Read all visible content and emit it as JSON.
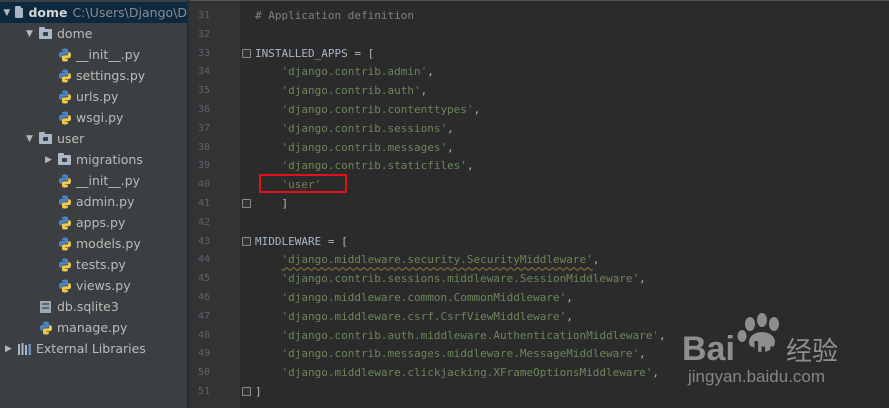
{
  "project": {
    "root_name": "dome",
    "root_path": "C:\\Users\\Django\\D",
    "tree": [
      {
        "label": "dome",
        "depth": 1,
        "kind": "pkg-folder",
        "expanded": true
      },
      {
        "label": "__init__.py",
        "depth": 2,
        "kind": "py"
      },
      {
        "label": "settings.py",
        "depth": 2,
        "kind": "py"
      },
      {
        "label": "urls.py",
        "depth": 2,
        "kind": "py"
      },
      {
        "label": "wsgi.py",
        "depth": 2,
        "kind": "py"
      },
      {
        "label": "user",
        "depth": 1,
        "kind": "pkg-folder",
        "expanded": true
      },
      {
        "label": "migrations",
        "depth": 2,
        "kind": "pkg-folder",
        "expanded": false
      },
      {
        "label": "__init__.py",
        "depth": 2,
        "kind": "py"
      },
      {
        "label": "admin.py",
        "depth": 2,
        "kind": "py"
      },
      {
        "label": "apps.py",
        "depth": 2,
        "kind": "py"
      },
      {
        "label": "models.py",
        "depth": 2,
        "kind": "py"
      },
      {
        "label": "tests.py",
        "depth": 2,
        "kind": "py"
      },
      {
        "label": "views.py",
        "depth": 2,
        "kind": "py"
      },
      {
        "label": "db.sqlite3",
        "depth": 1,
        "kind": "db"
      },
      {
        "label": "manage.py",
        "depth": 1,
        "kind": "py"
      }
    ],
    "external_libraries": "External Libraries"
  },
  "editor": {
    "lines": [
      {
        "num": "31",
        "parts": [
          {
            "t": "# Application definition",
            "c": "com"
          }
        ]
      },
      {
        "num": "32",
        "parts": []
      },
      {
        "num": "33",
        "parts": [
          {
            "t": "INSTALLED_APPS = [",
            "c": ""
          }
        ],
        "fold": true
      },
      {
        "num": "34",
        "parts": [
          {
            "t": "    ",
            "c": ""
          },
          {
            "t": "'django.contrib.admin'",
            "c": "str"
          },
          {
            "t": ",",
            "c": ""
          }
        ]
      },
      {
        "num": "35",
        "parts": [
          {
            "t": "    ",
            "c": ""
          },
          {
            "t": "'django.contrib.auth'",
            "c": "str"
          },
          {
            "t": ",",
            "c": ""
          }
        ]
      },
      {
        "num": "36",
        "parts": [
          {
            "t": "    ",
            "c": ""
          },
          {
            "t": "'django.contrib.contenttypes'",
            "c": "str"
          },
          {
            "t": ",",
            "c": ""
          }
        ]
      },
      {
        "num": "37",
        "parts": [
          {
            "t": "    ",
            "c": ""
          },
          {
            "t": "'django.contrib.sessions'",
            "c": "str"
          },
          {
            "t": ",",
            "c": ""
          }
        ]
      },
      {
        "num": "38",
        "parts": [
          {
            "t": "    ",
            "c": ""
          },
          {
            "t": "'django.contrib.messages'",
            "c": "str"
          },
          {
            "t": ",",
            "c": ""
          }
        ]
      },
      {
        "num": "39",
        "parts": [
          {
            "t": "    ",
            "c": ""
          },
          {
            "t": "'django.contrib.staticfiles'",
            "c": "str"
          },
          {
            "t": ",",
            "c": ""
          }
        ]
      },
      {
        "num": "40",
        "parts": [
          {
            "t": "    ",
            "c": ""
          },
          {
            "t": "'user'",
            "c": "str"
          }
        ]
      },
      {
        "num": "41",
        "parts": [
          {
            "t": "    ]",
            "c": ""
          }
        ],
        "fold": true
      },
      {
        "num": "42",
        "parts": []
      },
      {
        "num": "43",
        "parts": [
          {
            "t": "MIDDLEWARE = [",
            "c": ""
          }
        ],
        "fold": true
      },
      {
        "num": "44",
        "parts": [
          {
            "t": "    ",
            "c": ""
          },
          {
            "t": "'django.middleware.security.SecurityMiddleware'",
            "c": "str sq"
          },
          {
            "t": ",",
            "c": ""
          }
        ]
      },
      {
        "num": "45",
        "parts": [
          {
            "t": "    ",
            "c": ""
          },
          {
            "t": "'django.contrib.sessions.middleware.SessionMiddleware'",
            "c": "str"
          },
          {
            "t": ",",
            "c": ""
          }
        ]
      },
      {
        "num": "46",
        "parts": [
          {
            "t": "    ",
            "c": ""
          },
          {
            "t": "'django.middleware.common.CommonMiddleware'",
            "c": "str"
          },
          {
            "t": ",",
            "c": ""
          }
        ]
      },
      {
        "num": "47",
        "parts": [
          {
            "t": "    ",
            "c": ""
          },
          {
            "t": "'django.middleware.csrf.CsrfViewMiddleware'",
            "c": "str"
          },
          {
            "t": ",",
            "c": ""
          }
        ]
      },
      {
        "num": "48",
        "parts": [
          {
            "t": "    ",
            "c": ""
          },
          {
            "t": "'django.contrib.auth.middleware.AuthenticationMiddleware'",
            "c": "str"
          },
          {
            "t": ",",
            "c": ""
          }
        ]
      },
      {
        "num": "49",
        "parts": [
          {
            "t": "    ",
            "c": ""
          },
          {
            "t": "'django.contrib.messages.middleware.MessageMiddleware'",
            "c": "str"
          },
          {
            "t": ",",
            "c": ""
          }
        ]
      },
      {
        "num": "50",
        "parts": [
          {
            "t": "    ",
            "c": ""
          },
          {
            "t": "'django.middleware.clickjacking.XFrameOptionsMiddleware'",
            "c": "str"
          },
          {
            "t": ",",
            "c": ""
          }
        ]
      },
      {
        "num": "51",
        "parts": [
          {
            "t": "]",
            "c": ""
          }
        ],
        "fold": true
      }
    ]
  },
  "watermark": {
    "brand_text": "Bai",
    "brand_text_2": "du",
    "brand_cn": "经验",
    "url": "jingyan.baidu.com"
  },
  "colors": {
    "highlight_box": "#e2101a",
    "string": "#6a8759",
    "comment": "#808080"
  }
}
